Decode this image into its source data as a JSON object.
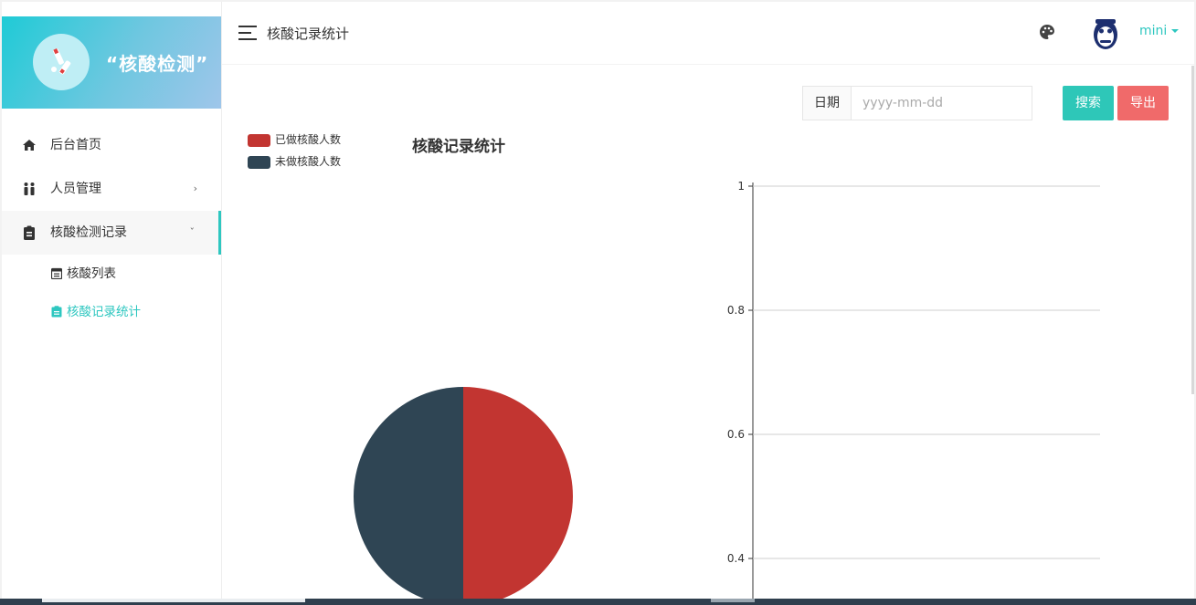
{
  "brand": {
    "title": "“核酸检测”"
  },
  "menu": {
    "items": [
      {
        "label": "后台首页",
        "icon": "home-icon"
      },
      {
        "label": "人员管理",
        "icon": "people-icon",
        "arrow": "›"
      },
      {
        "label": "核酸检测记录",
        "icon": "clipboard-icon",
        "arrow": "ˇ"
      }
    ],
    "sub": [
      {
        "label": "核酸列表",
        "icon": "calendar-icon"
      },
      {
        "label": "核酸记录统计",
        "icon": "clipboard-icon"
      }
    ]
  },
  "header": {
    "title": "核酸记录统计",
    "user": "mini"
  },
  "search": {
    "label": "日期",
    "placeholder": "yyyy-mm-dd",
    "search_btn": "搜索",
    "export_btn": "导出"
  },
  "colors": {
    "accent": "#2ec7c0",
    "done": "#c23531",
    "not_done": "#2f4554",
    "export": "#f06a6a"
  },
  "chart_data": [
    {
      "type": "pie",
      "title": "核酸记录统计",
      "legend": [
        "已做核酸人数",
        "未做核酸人数"
      ],
      "values": [
        1,
        1
      ]
    },
    {
      "type": "bar",
      "title": "",
      "ytick_labels": [
        "1",
        "0.8",
        "0.6",
        "0.4"
      ],
      "ylim": [
        0,
        1
      ],
      "grid": true
    }
  ]
}
